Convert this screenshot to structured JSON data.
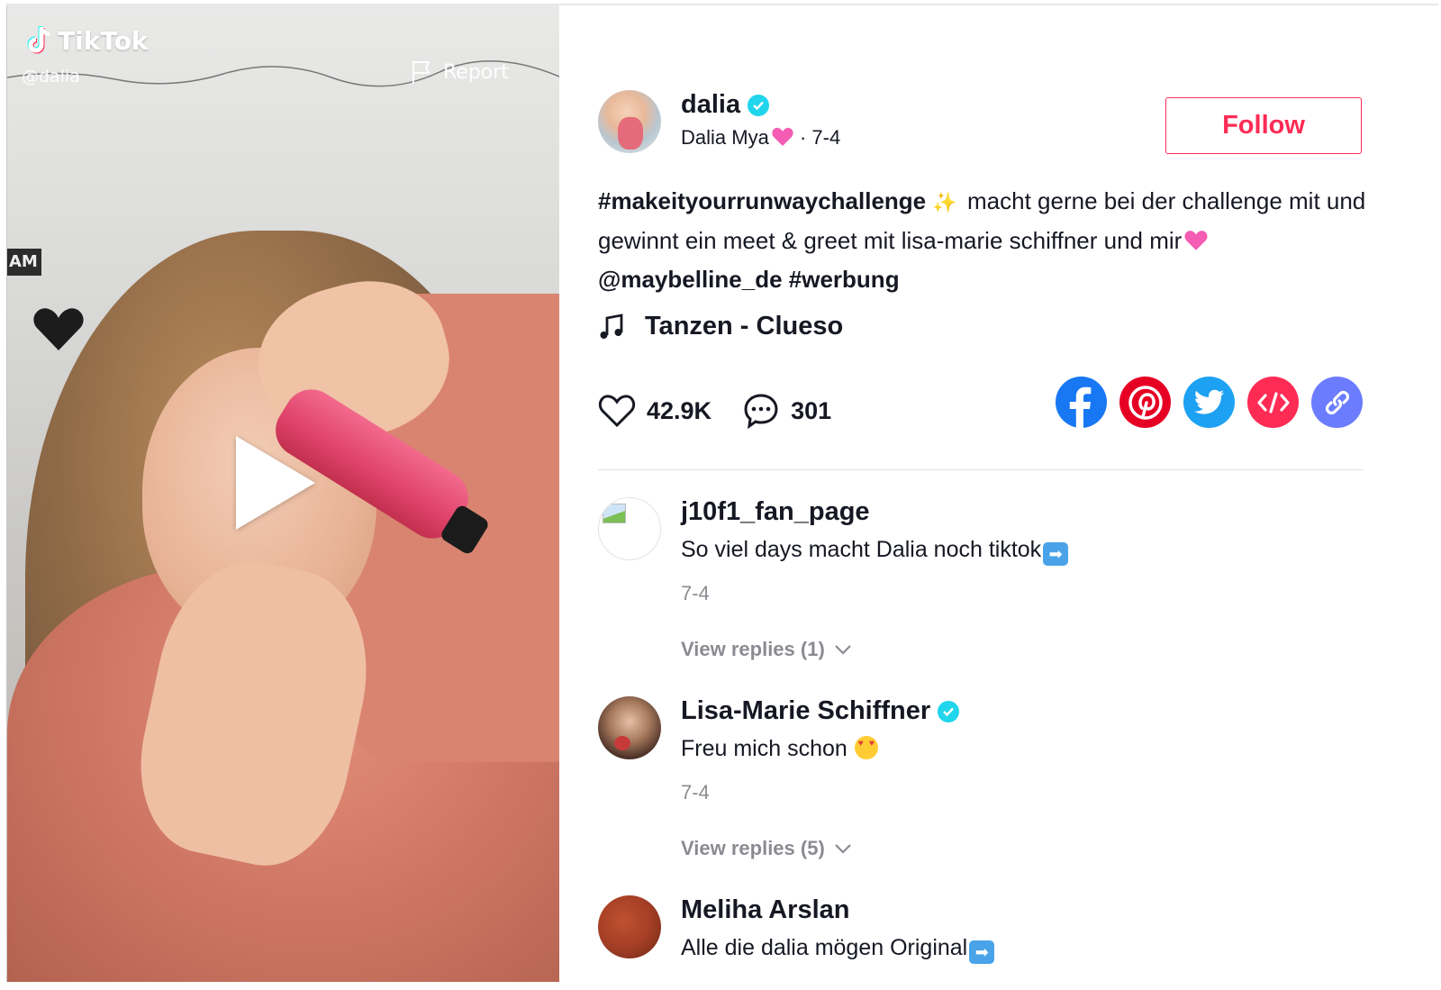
{
  "video": {
    "brand": "TikTok",
    "handle": "@dalia",
    "report_label": "Report"
  },
  "author": {
    "username": "dalia",
    "nickname": "Dalia Mya",
    "date": "· 7-4",
    "follow_label": "Follow"
  },
  "description": {
    "hashtag1": "#makeityourrunwaychallenge",
    "sparkle": "✨",
    "text": " macht gerne bei der challenge mit und gewinnt ein meet & greet mit lisa-marie schiffner und mir",
    "mention": "@maybelline_de",
    "hashtag2": "#werbung"
  },
  "music": {
    "title": "Tanzen - Clueso"
  },
  "stats": {
    "likes": "42.9K",
    "comments": "301"
  },
  "share": {
    "icons": [
      "facebook-icon",
      "pinterest-icon",
      "twitter-icon",
      "embed-icon",
      "link-icon"
    ]
  },
  "comments": [
    {
      "username": "j10f1_fan_page",
      "text": "So viel days macht Dalia noch tiktok",
      "date": "7-4",
      "replies": "View replies (1)"
    },
    {
      "username": "Lisa-Marie Schiffner",
      "text": "Freu mich schon",
      "date": "7-4",
      "replies": "View replies (5)"
    },
    {
      "username": "Meliha Arslan",
      "text": "Alle die dalia mögen Original"
    }
  ],
  "colors": {
    "accent": "#fe2c55",
    "verified": "#20d5ec",
    "facebook": "#1877f2",
    "pinterest": "#e60023",
    "twitter": "#1da1f2",
    "link": "#6c7cff"
  }
}
